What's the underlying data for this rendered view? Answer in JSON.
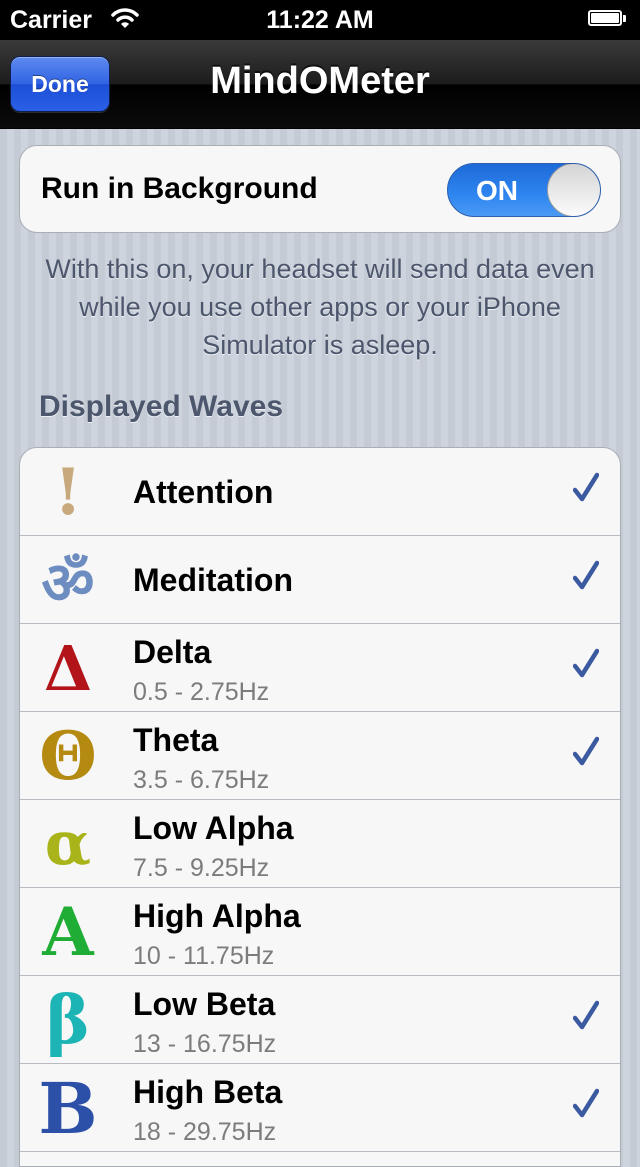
{
  "status_bar": {
    "carrier": "Carrier",
    "time": "11:22 AM"
  },
  "nav": {
    "title": "MindOMeter",
    "done_label": "Done"
  },
  "background_setting": {
    "label": "Run in Background",
    "toggle_label": "ON",
    "toggle_on": true,
    "footer": "With this on, your headset will send data even while you use other apps or your iPhone Simulator is asleep."
  },
  "displayed_waves": {
    "header": "Displayed Waves",
    "items": [
      {
        "icon": "!",
        "icon_name": "exclamation-icon",
        "color": "#c8a97e",
        "title": "Attention",
        "subtitle": "",
        "checked": true
      },
      {
        "icon": "ॐ",
        "icon_name": "om-icon",
        "color": "#6d8cc0",
        "title": "Meditation",
        "subtitle": "",
        "checked": true
      },
      {
        "icon": "Δ",
        "icon_name": "delta-icon",
        "color": "#b2141a",
        "title": "Delta",
        "subtitle": "0.5 - 2.75Hz",
        "checked": true
      },
      {
        "icon": "Θ",
        "icon_name": "theta-icon",
        "color": "#b58a11",
        "title": "Theta",
        "subtitle": "3.5 - 6.75Hz",
        "checked": true
      },
      {
        "icon": "α",
        "icon_name": "alpha-icon",
        "color": "#a8b41a",
        "title": "Low Alpha",
        "subtitle": "7.5 - 9.25Hz",
        "checked": false
      },
      {
        "icon": "A",
        "icon_name": "capital-alpha-icon",
        "color": "#1fad35",
        "title": "High Alpha",
        "subtitle": "10 - 11.75Hz",
        "checked": false
      },
      {
        "icon": "β",
        "icon_name": "beta-icon",
        "color": "#1cb4b4",
        "title": "Low Beta",
        "subtitle": "13 - 16.75Hz",
        "checked": true
      },
      {
        "icon": "B",
        "icon_name": "capital-beta-icon",
        "color": "#2c4fa8",
        "title": "High Beta",
        "subtitle": "18 - 29.75Hz",
        "checked": true
      }
    ]
  },
  "colors": {
    "checkmark": "#3b5aa0",
    "toggle_on": "#2f86f0",
    "done_button": "#2f63e2"
  }
}
